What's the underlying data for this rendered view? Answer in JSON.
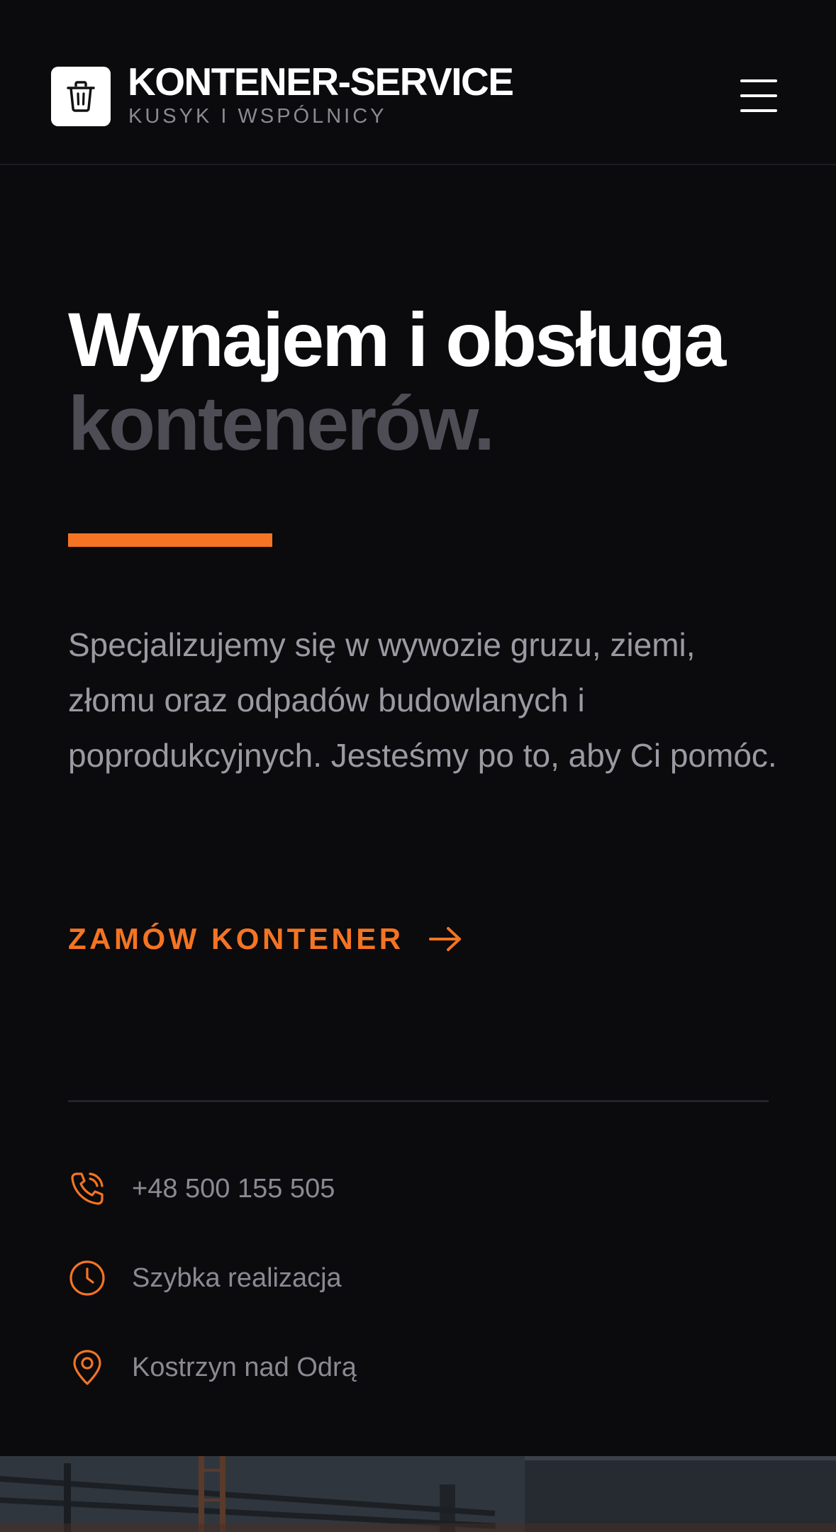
{
  "header": {
    "brand_name": "KONTENER-SERVICE",
    "brand_sub": "KUSYK I WSPÓLNICY",
    "logo_icon": "trash-bin-icon",
    "menu_icon": "hamburger-menu-icon"
  },
  "hero": {
    "title_line1": "Wynajem i obsługa",
    "title_line2": "kontenerów.",
    "description": "Specjalizujemy się w wywozie gruzu, ziemi, złomu oraz odpadów budowlanych i poprodukcyjnych. Jesteśmy po to, aby Ci pomóc.",
    "cta_label": "ZAMÓW KONTENER",
    "cta_icon": "arrow-right-icon"
  },
  "info": {
    "phone": "+48 500 155 505",
    "phone_icon": "phone-icon",
    "speed": "Szybka realizacja",
    "speed_icon": "clock-icon",
    "location": "Kostrzyn nad Odrą",
    "location_icon": "map-pin-icon"
  },
  "colors": {
    "background": "#0b0a0d",
    "accent": "#f47423",
    "muted_title": "#4e4d55",
    "body_text": "#9b9aa2"
  }
}
